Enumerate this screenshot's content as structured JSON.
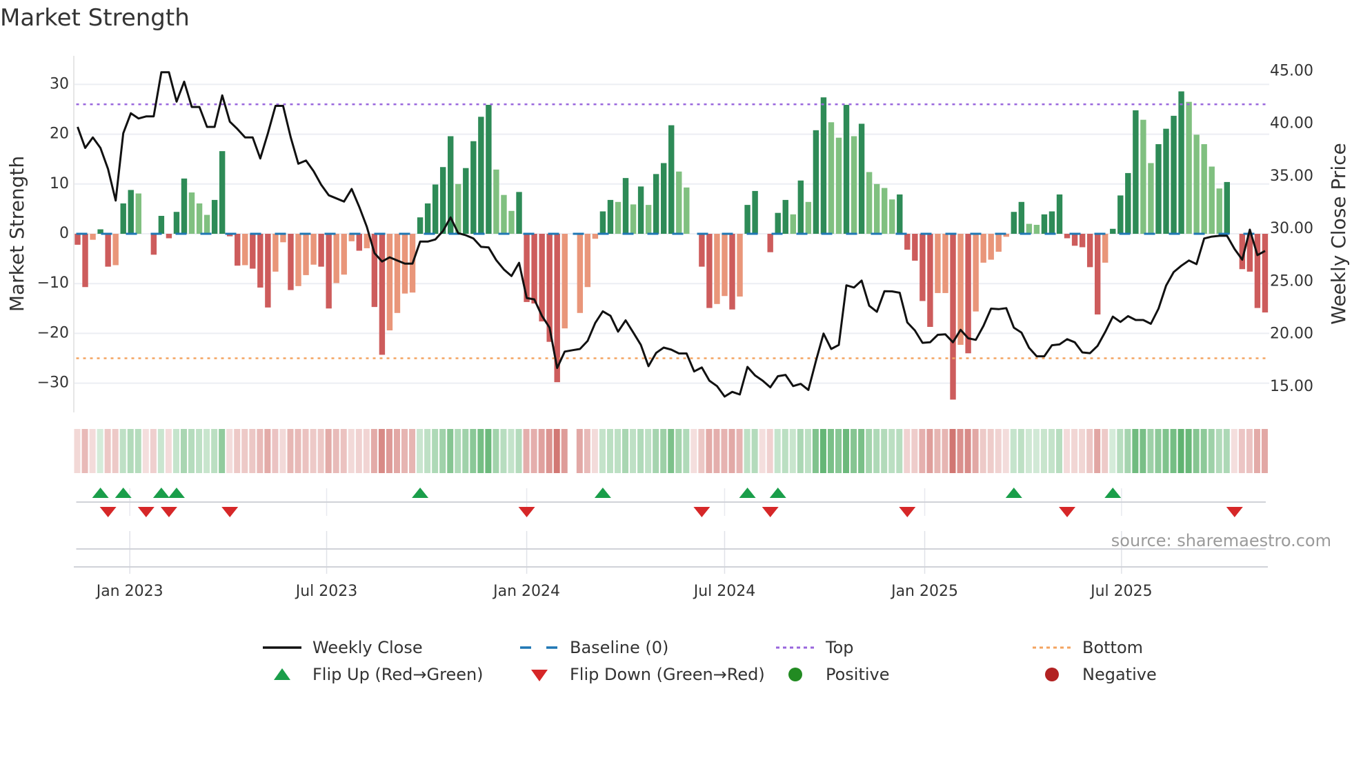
{
  "title": "Market Strength",
  "source": "source: sharemaestro.com",
  "legend": {
    "weekly_close": "Weekly Close",
    "baseline": "Baseline (0)",
    "top": "Top",
    "bottom": "Bottom",
    "flip_up": "Flip Up (Red→Green)",
    "flip_down": "Flip Down (Green→Red)",
    "positive": "Positive",
    "negative": "Negative"
  },
  "colors": {
    "strong_up": "#2e8b57",
    "weak_up": "#80c080",
    "strong_down": "#cd5c5c",
    "weak_down": "#e9967a",
    "baseline": "#1f77b4",
    "top": "#9966dd",
    "bottom": "#f4a460",
    "price": "#111111",
    "flip_up": "#1a9e4a",
    "flip_down": "#d62728",
    "positive": "#228b22",
    "negative": "#b22222"
  },
  "chart_data": {
    "type": "bar",
    "title": "Market Strength",
    "ylabel": "Market Strength",
    "y2label": "Weekly Close Price",
    "ylim": [
      -36,
      36
    ],
    "y2lim": [
      12.5,
      47.2
    ],
    "yticks": [
      "30",
      "20",
      "10",
      "0",
      "−10",
      "−20",
      "−30"
    ],
    "ytick_values": [
      30,
      20,
      10,
      0,
      -10,
      -20,
      -30
    ],
    "y2ticks": [
      "45.00",
      "40.00",
      "35.00",
      "30.00",
      "25.00",
      "20.00",
      "15.00"
    ],
    "y2tick_values": [
      45,
      40,
      35,
      30,
      25,
      20,
      15
    ],
    "xticks": [
      {
        "label": "Jan 2023",
        "date": "2023-01-01"
      },
      {
        "label": "Jul 2023",
        "date": "2023-07-01"
      },
      {
        "label": "Jan 2024",
        "date": "2024-01-01"
      },
      {
        "label": "Jul 2024",
        "date": "2024-07-01"
      },
      {
        "label": "Jan 2025",
        "date": "2025-01-01"
      },
      {
        "label": "Jul 2025",
        "date": "2025-07-01"
      }
    ],
    "start_week": "2022-11-14",
    "frequency": "weekly",
    "top_level": 26,
    "bottom_level": -25,
    "baseline": 0,
    "strength": [
      -2.2,
      -10.7,
      -1.2,
      0.9,
      -6.6,
      -6.3,
      6.1,
      8.8,
      8.1,
      0,
      -4.2,
      3.6,
      -0.9,
      4.4,
      11.1,
      8.3,
      6.1,
      3.8,
      6.8,
      16.6,
      -0.5,
      -6.4,
      -6.3,
      -7.0,
      -10.8,
      -14.8,
      -7.6,
      -1.7,
      -11.3,
      -10.5,
      -8.3,
      -6.2,
      -6.6,
      -15.0,
      -9.9,
      -8.2,
      -1.5,
      -3.4,
      -2.9,
      -14.7,
      -24.3,
      -19.4,
      -15.9,
      -12.0,
      -11.8,
      3.3,
      6.1,
      9.9,
      13.4,
      19.6,
      10.0,
      13.2,
      18.6,
      23.5,
      25.9,
      12.9,
      7.8,
      4.6,
      8.4,
      -13.7,
      -14.0,
      -17.6,
      -21.7,
      -29.8,
      -19.0,
      0,
      -15.9,
      -10.7,
      -1.0,
      4.5,
      6.8,
      6.4,
      11.2,
      5.9,
      9.5,
      5.8,
      12.0,
      14.2,
      21.8,
      12.5,
      9.3,
      0,
      -6.6,
      -14.9,
      -14.1,
      -12.5,
      -15.2,
      -12.6,
      5.8,
      8.6,
      0,
      -3.7,
      4.2,
      6.8,
      3.9,
      10.7,
      6.4,
      20.8,
      27.4,
      22.4,
      19.3,
      25.9,
      19.6,
      22.1,
      12.4,
      10.0,
      9.2,
      6.9,
      7.9,
      -3.2,
      -5.4,
      -13.5,
      -18.7,
      -11.9,
      -11.9,
      -33.3,
      -22.3,
      -24.0,
      -15.6,
      -5.8,
      -5.2,
      -3.6,
      -0.6,
      4.4,
      6.4,
      2.0,
      1.8,
      3.9,
      4.5,
      7.9,
      -0.9,
      -2.4,
      -2.7,
      -6.7,
      -16.2,
      -5.8,
      1.0,
      7.7,
      12.2,
      24.8,
      22.9,
      14.2,
      18.0,
      21.1,
      23.7,
      28.6,
      26.5,
      19.9,
      18.0,
      13.5,
      9.1,
      10.4,
      0,
      -7.1,
      -7.6,
      -14.9,
      -15.8
    ],
    "bar_class": "RRrGRrGGg_RGRGGgggGGRRrRRRrrRrrrRRrrrRrRRrrrrGGGGGgGGGGgggGRRRRRr_rrrGGgGgGgGGGgg_RRrrRrGG_RGGgGgGGggGgGggggGRRRRrrRrRrrrrrGGggGGGRRRRRrGGGGggGGGGgggggG_RRRR",
    "weekly_close": [
      39.9,
      37.9,
      38.9,
      37.9,
      35.9,
      32.9,
      39.3,
      41.2,
      40.7,
      40.9,
      40.9,
      45.1,
      45.1,
      42.3,
      44.2,
      41.8,
      41.8,
      39.9,
      39.9,
      42.9,
      40.4,
      39.7,
      38.9,
      38.9,
      36.9,
      39.3,
      41.9,
      41.9,
      38.9,
      36.4,
      36.7,
      35.7,
      34.4,
      33.4,
      33.1,
      32.8,
      34.0,
      32.3,
      30.4,
      27.9,
      27.1,
      27.5,
      27.2,
      26.9,
      26.9,
      29.0,
      29.0,
      29.2,
      30.0,
      31.3,
      29.8,
      29.6,
      29.3,
      28.5,
      28.44,
      27.23,
      26.35,
      25.72,
      26.98,
      23.63,
      23.5,
      21.94,
      20.81,
      16.98,
      18.54,
      18.67,
      18.79,
      19.55,
      21.26,
      22.37,
      21.94,
      20.43,
      21.51,
      20.35,
      19.17,
      17.15,
      18.41,
      18.92,
      18.72,
      18.36,
      18.36,
      16.65,
      17.03,
      15.77,
      15.26,
      14.26,
      14.71,
      14.46,
      17.08,
      16.27,
      15.77,
      15.14,
      16.2,
      16.32,
      15.26,
      15.47,
      14.89,
      17.66,
      20.25,
      18.79,
      19.17,
      24.84,
      24.63,
      25.29,
      22.9,
      22.32,
      24.28,
      24.26,
      24.13,
      21.31,
      20.55,
      19.37,
      19.42,
      20.13,
      20.18,
      19.42,
      20.61,
      19.8,
      19.65,
      20.98,
      22.62,
      22.57,
      22.67,
      20.81,
      20.35,
      18.89,
      18.09,
      18.09,
      19.14,
      19.22,
      19.72,
      19.42,
      18.46,
      18.39,
      19.09,
      20.4,
      21.86,
      21.36,
      21.91,
      21.54,
      21.54,
      21.18,
      22.62,
      24.81,
      26.1,
      26.7,
      27.2,
      26.85,
      29.29,
      29.47,
      29.55,
      29.55,
      28.29,
      27.28,
      30.13,
      27.71,
      28.11
    ],
    "heat_gaps": [
      65
    ],
    "flip_up_weeks": [
      3,
      6,
      11,
      13,
      45,
      69,
      88,
      92,
      123,
      136
    ],
    "flip_down_weeks": [
      4,
      9,
      12,
      20,
      59,
      82,
      91,
      109,
      130,
      152
    ]
  }
}
